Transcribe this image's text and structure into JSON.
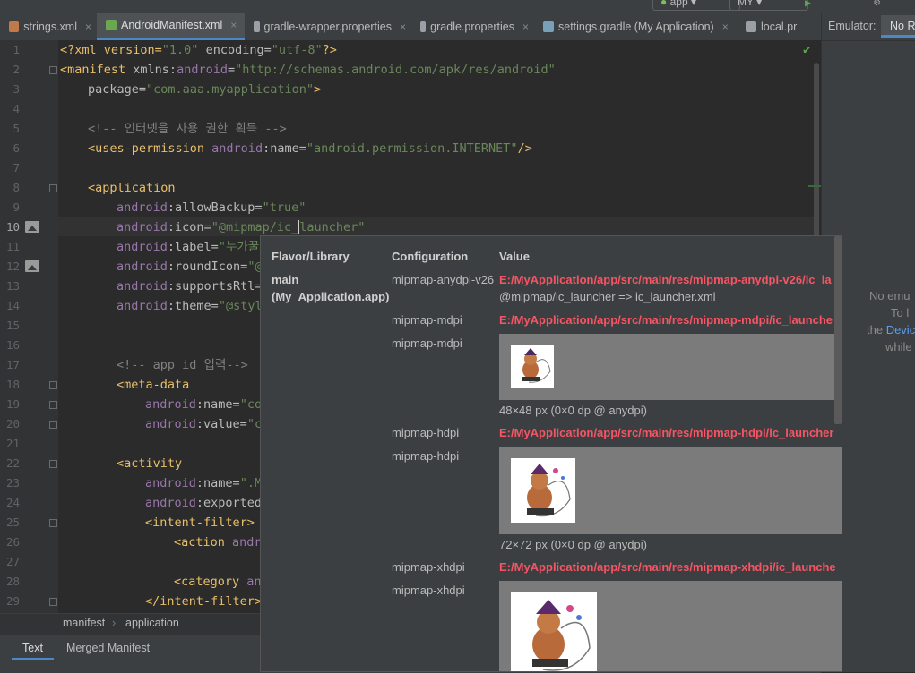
{
  "toolbar": {
    "run_config": "app",
    "device": "MY"
  },
  "tabs": [
    {
      "label": "strings.xml",
      "color": "#c07a4a"
    },
    {
      "label": "AndroidManifest.xml",
      "color": "#6aa84f",
      "active": true
    },
    {
      "label": "gradle-wrapper.properties",
      "color": "#9aa0a6"
    },
    {
      "label": "gradle.properties",
      "color": "#9aa0a6"
    },
    {
      "label": "settings.gradle (My Application)",
      "color": "#7aa0b8"
    },
    {
      "label": "local.pr",
      "color": "#9aa0a6"
    }
  ],
  "close_glyph": "×",
  "line_numbers": [
    "1",
    "2",
    "3",
    "4",
    "5",
    "6",
    "7",
    "8",
    "9",
    "10",
    "11",
    "12",
    "13",
    "14",
    "15",
    "16",
    "17",
    "18",
    "19",
    "20",
    "21",
    "22",
    "23",
    "24",
    "25",
    "26",
    "27",
    "28",
    "29"
  ],
  "code": {
    "l1": {
      "a": "<?xml version=",
      "b": "\"1.0\"",
      "c": " encoding=",
      "d": "\"utf-8\"",
      "e": "?>"
    },
    "l2": {
      "a": "<manifest ",
      "b": "xmlns:",
      "c": "android",
      "d": "=",
      "e": "\"http://schemas.android.com/apk/res/android\""
    },
    "l3": {
      "a": "package",
      "b": "=",
      "c": "\"com.aaa.myapplication\"",
      "d": ">"
    },
    "l5": "<!-- 인터넷을 사용 권한 획득 -->",
    "l6": {
      "a": "<uses-permission ",
      "b": "android",
      "c": ":name=",
      "d": "\"android.permission.INTERNET\"",
      "e": "/>"
    },
    "l8": "<application",
    "l9": {
      "a": "android",
      "b": ":allowBackup=",
      "c": "\"true\""
    },
    "l10": {
      "a": "android",
      "b": ":icon=",
      "c": "\"@mipmap/ic_",
      "d": "launcher\""
    },
    "l11": {
      "a": "android",
      "b": ":label=",
      "c": "\"누가꿀"
    },
    "l12": {
      "a": "android",
      "b": ":roundIcon=",
      "c": "\"@"
    },
    "l13": {
      "a": "android",
      "b": ":supportsRtl="
    },
    "l14": {
      "a": "android",
      "b": ":theme=",
      "c": "\"@styl"
    },
    "l17": "<!-- app id 입력-->",
    "l18": "<meta-data",
    "l19": {
      "a": "android",
      "b": ":name=",
      "c": "\"co"
    },
    "l20": {
      "a": "android",
      "b": ":value=",
      "c": "\"c"
    },
    "l22": "<activity",
    "l23": {
      "a": "android",
      "b": ":name=",
      "c": "\".M"
    },
    "l24": {
      "a": "android",
      "b": ":exported"
    },
    "l25": "<intent-filter>",
    "l26": {
      "a": "<action ",
      "b": "andr"
    },
    "l28": {
      "a": "<category ",
      "b": "an"
    },
    "l29": "</intent-filter>"
  },
  "breadcrumb": {
    "root": "manifest",
    "sep": "›",
    "child": "application"
  },
  "bottom_tabs": [
    "Text",
    "Merged Manifest"
  ],
  "emulator": {
    "title": "Emulator:",
    "tab": "No R",
    "line1": "No emu",
    "line2": "To l",
    "line3a": "the ",
    "line3b": "Devic",
    "line4": "while"
  },
  "popup": {
    "headers": {
      "flavor": "Flavor/Library",
      "config": "Configuration",
      "value": "Value"
    },
    "library_name": "main",
    "library_sub": "(My_Application.app)",
    "rows": [
      {
        "config": "mipmap-anydpi-v26",
        "path": "E:/MyApplication/app/src/main/res/mipmap-anydpi-v26/ic_la",
        "ref": "@mipmap/ic_launcher => ic_launcher.xml"
      },
      {
        "config": "mipmap-mdpi",
        "path": "E:/MyApplication/app/src/main/res/mipmap-mdpi/ic_launche"
      },
      {
        "config": "mipmap-mdpi",
        "caption": "48×48 px (0×0 dp @ anydpi)"
      },
      {
        "config": "mipmap-hdpi",
        "path": "E:/MyApplication/app/src/main/res/mipmap-hdpi/ic_launcher"
      },
      {
        "config": "mipmap-hdpi",
        "caption": "72×72 px (0×0 dp @ anydpi)"
      },
      {
        "config": "mipmap-xhdpi",
        "path": "E:/MyApplication/app/src/main/res/mipmap-xhdpi/ic_launche"
      },
      {
        "config": "mipmap-xhdpi"
      }
    ]
  }
}
